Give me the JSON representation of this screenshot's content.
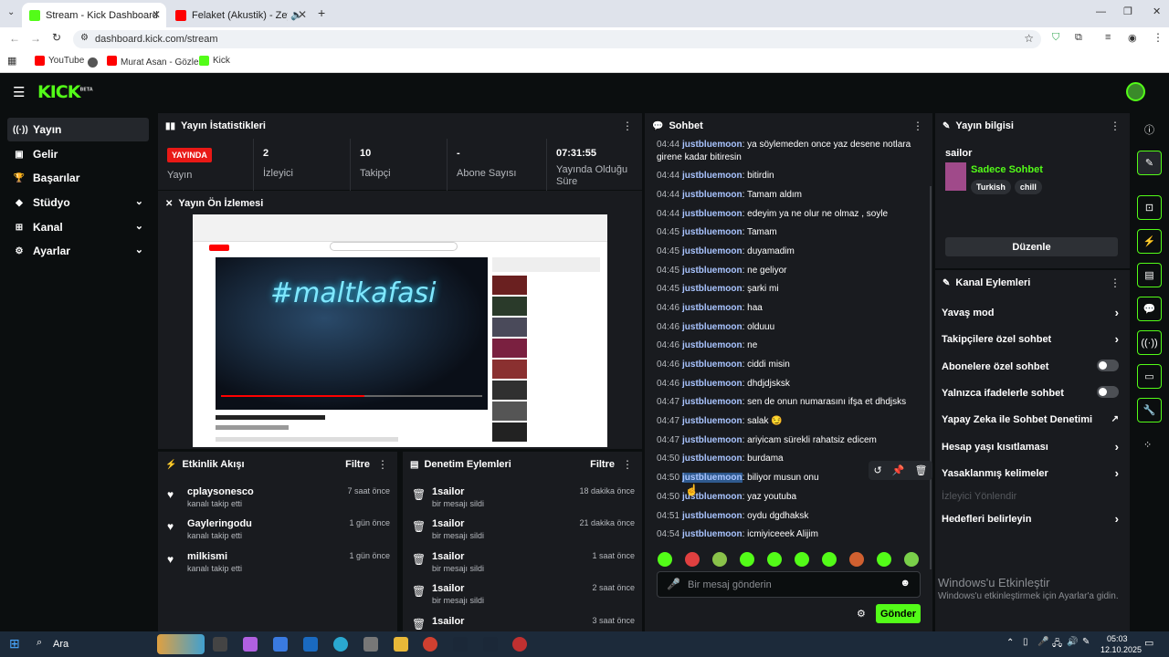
{
  "browser": {
    "tabs": [
      {
        "title": "Stream - Kick Dashboard"
      },
      {
        "title": "Felaket (Akustik) - Zeynep B"
      }
    ],
    "new_tab": "+",
    "url": "dashboard.kick.com/stream",
    "bookmarks": [
      "YouTube",
      "Murat Asan - Gözler...",
      "Kick"
    ]
  },
  "kick": {
    "logo": "KICK",
    "logo_badge": "BETA"
  },
  "nav": [
    {
      "label": "Yayın",
      "icon": "broadcast-icon"
    },
    {
      "label": "Gelir",
      "icon": "revenue-icon"
    },
    {
      "label": "Başarılar",
      "icon": "trophy-icon"
    },
    {
      "label": "Stüdyo",
      "icon": "studio-icon"
    },
    {
      "label": "Kanal",
      "icon": "channel-icon"
    },
    {
      "label": "Ayarlar",
      "icon": "gear-icon"
    }
  ],
  "stats": {
    "title": "Yayın İstatistikleri",
    "items": [
      {
        "value": "YAYINDA",
        "label": "Yayın"
      },
      {
        "value": "2",
        "label": "İzleyici"
      },
      {
        "value": "10",
        "label": "Takipçi"
      },
      {
        "value": "-",
        "label": "Abone Sayısı"
      },
      {
        "value": "07:31:55",
        "label": "Yayında Olduğu Süre"
      }
    ]
  },
  "preview": {
    "title": "Yayın Ön İzlemesi",
    "video_text": "#maltkafasi"
  },
  "activity": {
    "title": "Etkinlik Akışı",
    "filter": "Filtre",
    "items": [
      {
        "name": "cplaysonesco",
        "sub": "kanalı takip etti",
        "time": "7 saat önce"
      },
      {
        "name": "Gayleringodu",
        "sub": "kanalı takip etti",
        "time": "1 gün önce"
      },
      {
        "name": "milkismi",
        "sub": "kanalı takip etti",
        "time": "1 gün önce"
      }
    ]
  },
  "moderation": {
    "title": "Denetim Eylemleri",
    "filter": "Filtre",
    "items": [
      {
        "name": "1sailor",
        "sub": "bir mesajı sildi",
        "time": "18 dakika önce"
      },
      {
        "name": "1sailor",
        "sub": "bir mesajı sildi",
        "time": "21 dakika önce"
      },
      {
        "name": "1sailor",
        "sub": "bir mesajı sildi",
        "time": "1 saat önce"
      },
      {
        "name": "1sailor",
        "sub": "bir mesajı sildi",
        "time": "2 saat önce"
      },
      {
        "name": "1sailor",
        "sub": "",
        "time": "3 saat önce"
      }
    ]
  },
  "chat": {
    "title": "Sohbet",
    "messages": [
      {
        "time": "04:44",
        "user": "justbluemoon",
        "text": ": ya söylemeden once yaz desene notlara girene kadar bitiresin"
      },
      {
        "time": "04:44",
        "user": "justbluemoon",
        "text": ": bitirdin"
      },
      {
        "time": "04:44",
        "user": "justbluemoon",
        "text": ": Tamam aldım"
      },
      {
        "time": "04:44",
        "user": "justbluemoon",
        "text": ": edeyim ya ne olur ne olmaz , soyle"
      },
      {
        "time": "04:45",
        "user": "justbluemoon",
        "text": ": Tamam"
      },
      {
        "time": "04:45",
        "user": "justbluemoon",
        "text": ": duyamadim"
      },
      {
        "time": "04:45",
        "user": "justbluemoon",
        "text": ": ne geliyor"
      },
      {
        "time": "04:45",
        "user": "justbluemoon",
        "text": ": şarki mi"
      },
      {
        "time": "04:46",
        "user": "justbluemoon",
        "text": ": haa"
      },
      {
        "time": "04:46",
        "user": "justbluemoon",
        "text": ": olduuu"
      },
      {
        "time": "04:46",
        "user": "justbluemoon",
        "text": ": ne"
      },
      {
        "time": "04:46",
        "user": "justbluemoon",
        "text": ": ciddi misin"
      },
      {
        "time": "04:46",
        "user": "justbluemoon",
        "text": ": dhdjdjsksk"
      },
      {
        "time": "04:47",
        "user": "justbluemoon",
        "text": ": sen de onun numarasını ifşa et dhdjsks"
      },
      {
        "time": "04:47",
        "user": "justbluemoon",
        "text": ": salak 😏"
      },
      {
        "time": "04:47",
        "user": "justbluemoon",
        "text": ": ariyicam sürekli rahatsiz edicem"
      },
      {
        "time": "04:50",
        "user": "justbluemoon",
        "text": ": burdama"
      },
      {
        "time": "04:50",
        "user": "justbluemoon",
        "text": ": biliyor musun onu"
      },
      {
        "time": "04:50",
        "user": "justbluemoon",
        "text": ": yaz youtuba"
      },
      {
        "time": "04:51",
        "user": "justbluemoon",
        "text": ": oydu dgdhaksk"
      },
      {
        "time": "04:54",
        "user": "justbluemoon",
        "text": ": icmiyiceeek Alijim"
      }
    ],
    "placeholder": "Bir mesaj gönderin",
    "send": "Gönder"
  },
  "stream_info": {
    "title": "Yayın bilgisi",
    "streamer": "sailor",
    "category": "Sadece Sohbet",
    "tags": [
      "Turkish",
      "chill"
    ],
    "edit": "Düzenle"
  },
  "channel_actions": {
    "title": "Kanal Eylemleri",
    "items": [
      {
        "label": "Yavaş mod",
        "control": "chevron"
      },
      {
        "label": "Takipçilere özel sohbet",
        "control": "chevron"
      },
      {
        "label": "Abonelere özel sohbet",
        "control": "toggle"
      },
      {
        "label": "Yalnızca ifadelerle sohbet",
        "control": "toggle"
      },
      {
        "label": "Yapay Zeka ile Sohbet Denetimi",
        "control": "external"
      },
      {
        "label": "Hesap yaşı kısıtlaması",
        "control": "chevron"
      },
      {
        "label": "Yasaklanmış kelimeler",
        "control": "chevron"
      },
      {
        "label": "İzleyici Yönlendir",
        "control": "disabled"
      },
      {
        "label": "Hedefleri belirleyin",
        "control": "chevron"
      }
    ]
  },
  "watermark": {
    "title": "Windows'u Etkinleştir",
    "sub": "Windows'u etkinleştirmek için Ayarlar'a gidin."
  },
  "taskbar": {
    "search": "Ara",
    "time": "05:03",
    "date": "12.10.2025"
  },
  "colors": {
    "accent": "#53fc18",
    "live": "#e91916",
    "username": "#a9c4ff"
  }
}
